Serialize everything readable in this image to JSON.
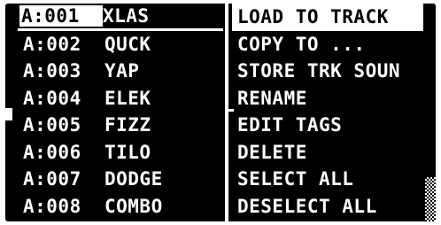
{
  "sound_list": {
    "items": [
      {
        "slot": "A:001",
        "name": "XLAS",
        "selected": true
      },
      {
        "slot": "A:002",
        "name": "QUCK",
        "selected": false
      },
      {
        "slot": "A:003",
        "name": "YAP",
        "selected": false
      },
      {
        "slot": "A:004",
        "name": "ELEK",
        "selected": false
      },
      {
        "slot": "A:005",
        "name": "FIZZ",
        "selected": false
      },
      {
        "slot": "A:006",
        "name": "TILO",
        "selected": false
      },
      {
        "slot": "A:007",
        "name": "DODGE",
        "selected": false
      },
      {
        "slot": "A:008",
        "name": "COMBO",
        "selected": false
      }
    ]
  },
  "context_menu": {
    "items": [
      {
        "label": "LOAD TO TRACK",
        "selected": true
      },
      {
        "label": "COPY TO ...",
        "selected": false
      },
      {
        "label": "STORE TRK SOUN",
        "selected": false
      },
      {
        "label": "RENAME",
        "selected": false
      },
      {
        "label": "EDIT TAGS",
        "selected": false
      },
      {
        "label": "DELETE",
        "selected": false
      },
      {
        "label": "SELECT ALL",
        "selected": false
      },
      {
        "label": "DESELECT ALL",
        "selected": false
      }
    ]
  },
  "colors": {
    "background": "#000000",
    "foreground": "#ffffff"
  },
  "scrollbar": {
    "position_fraction": 0.8
  }
}
